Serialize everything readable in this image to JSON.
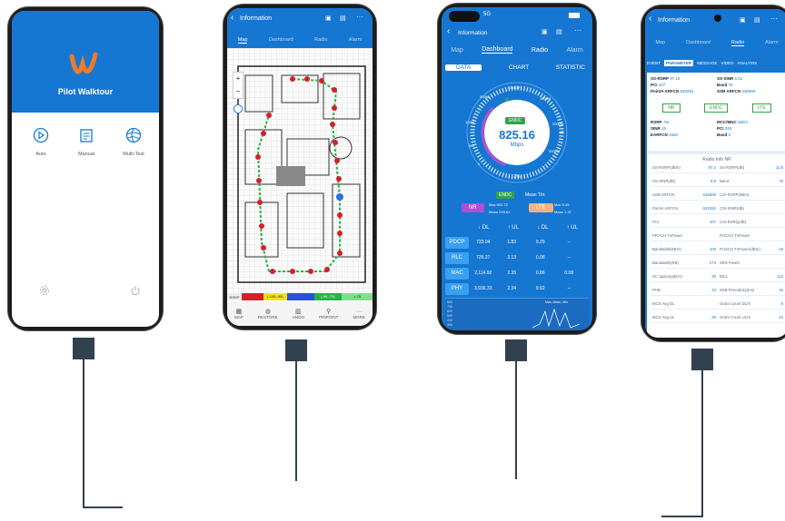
{
  "phone1": {
    "app_name": "Pilot Walktour",
    "modes": [
      {
        "label": "Auto",
        "icon": "play-circle-icon"
      },
      {
        "label": "Manual",
        "icon": "document-icon"
      },
      {
        "label": "Multi-Test",
        "icon": "globe-icon"
      }
    ],
    "footer_icons": [
      "settings-icon",
      "power-icon"
    ],
    "colors": {
      "header": "#1677d2",
      "logo": "#f07a28"
    }
  },
  "phone2": {
    "title": "Information",
    "tabs": [
      "Map",
      "Dashboard",
      "Radio",
      "Alarm"
    ],
    "active_tab": "Map",
    "legend_label": "RSRP",
    "legend_ranges": [
      "[-105,-95)",
      "[-95,-75)"
    ],
    "legend_end": ">-75",
    "toolbar": [
      {
        "label": "MAP",
        "icon": "layers-icon"
      },
      {
        "label": "RESTORE",
        "icon": "restore-icon"
      },
      {
        "label": "UNDO",
        "icon": "trash-icon"
      },
      {
        "label": "PINPOINT",
        "icon": "pin-icon"
      },
      {
        "label": "MORE",
        "icon": "more-icon"
      }
    ]
  },
  "phone3": {
    "status_signal": "5G",
    "title": "Information",
    "tabs": [
      "Map",
      "Dashboard",
      "Radio",
      "Alarm"
    ],
    "active_tab": "Dashboard",
    "subtabs": [
      "DATA",
      "CHART",
      "STATISTIC"
    ],
    "active_subtab": "DATA",
    "gauge": {
      "badge": "ENDC",
      "value": "825.16",
      "unit": "Mbps",
      "percent": "2%",
      "fill_fraction": 0.4,
      "scale": [
        "0",
        "5M",
        "100M",
        "500M",
        "1000M",
        "1500M",
        "2000M",
        "3000M"
      ]
    },
    "endc_row": {
      "badge": "ENDC",
      "mean": "Mean Thr."
    },
    "nr": {
      "label": "NR",
      "max": "Max 902.72",
      "mean": "Mean 249.81"
    },
    "lte": {
      "label": "LTE",
      "max": "Max 9.29",
      "mean": "Mean 1.37"
    },
    "direction_headers": [
      "DL",
      "UL",
      "DL",
      "UL"
    ],
    "layers": [
      {
        "name": "PDCP",
        "v": [
          "733.04",
          "1.83",
          "9.29",
          "--"
        ]
      },
      {
        "name": "RLC",
        "v": [
          "726.27",
          "3.13",
          "0.08",
          "--"
        ]
      },
      {
        "name": "MAC",
        "v": [
          "2,114.92",
          "2.35",
          "0.86",
          "0.08"
        ]
      },
      {
        "name": "PHY",
        "v": [
          "3,936.33",
          "2.34",
          "9.92",
          "--"
        ]
      }
    ],
    "chart_axis": [
      "800",
      "700",
      "600",
      "500",
      "400",
      "300"
    ],
    "chart_legend": "Max, Mean, Min"
  },
  "phone4": {
    "title": "Information",
    "tabs": [
      "Map",
      "Dashboard",
      "Radio",
      "Alarm"
    ],
    "active_tab": "Radio",
    "subtabs": [
      "EVENT",
      "PARAMETER",
      "MESSAGE",
      "VIDEO",
      "ANALYSIS"
    ],
    "active_subtab": "PARAMETER",
    "ss_block": [
      {
        "k": "SS-RSRP",
        "v": "97.19"
      },
      {
        "k": "SS-SINR",
        "v": "5.81"
      },
      {
        "k": "PCI",
        "v": "107"
      },
      {
        "k": "Band",
        "v": "78"
      },
      {
        "k": "PointA ARFCN",
        "v": "633292"
      },
      {
        "k": "SSB ARFCN",
        "v": "636668"
      }
    ],
    "tech_badges": [
      "NR",
      "ENDC",
      "LTE"
    ],
    "lte_block": [
      {
        "k": "RSRP",
        "v": "-94"
      },
      {
        "k": "MCC/MNC",
        "v": "460/1"
      },
      {
        "k": "SINR",
        "v": "15"
      },
      {
        "k": "PCI",
        "v": "330"
      },
      {
        "k": "EARFCN",
        "v": "1650"
      },
      {
        "k": "Band",
        "v": "3"
      }
    ],
    "table_title": "Radio Info NR",
    "table_rows": [
      [
        {
          "k": "SS-RSRP(dBm)",
          "v": "97.2"
        },
        {
          "k": "SS-RSRP(dB)",
          "v": "11.8"
        }
      ],
      [
        {
          "k": "SS-SINR(dB)",
          "v": "5.8"
        },
        {
          "k": "Band",
          "v": "78"
        }
      ],
      [
        {
          "k": "SSB ARFCN",
          "v": "636668"
        },
        {
          "k": "CSI-RSRP(dBm)",
          "v": ""
        }
      ],
      [
        {
          "k": "PointA ARFCN",
          "v": "633292"
        },
        {
          "k": "CSI-SINR(dB)",
          "v": ""
        }
      ],
      [
        {
          "k": "PCI",
          "v": "107"
        },
        {
          "k": "CSI-RSRQ(dB)",
          "v": ""
        }
      ],
      [
        {
          "k": "PRACH TxPower",
          "v": ""
        },
        {
          "k": "PUCCH TxPower",
          "v": ""
        }
      ],
      [
        {
          "k": "Bandwidth(MHz)",
          "v": "100"
        },
        {
          "k": "PUSCH TxPower(dBm)",
          "v": "19"
        }
      ],
      [
        {
          "k": "Bandwidth(RB)",
          "v": "273"
        },
        {
          "k": "SRS Power",
          "v": ""
        }
      ],
      [
        {
          "k": "SC Spacing(kHz)",
          "v": "30"
        },
        {
          "k": "MCL",
          "v": "113"
        }
      ],
      [
        {
          "k": "PHR",
          "v": "33"
        },
        {
          "k": "SSB Periodicity(ms)",
          "v": "20"
        }
      ],
      [
        {
          "k": "MCS Avg DL",
          "v": ""
        },
        {
          "k": "Grant Count DL/S",
          "v": "9"
        }
      ],
      [
        {
          "k": "MCS Avg UL",
          "v": "25"
        },
        {
          "k": "Grant Count UL/S",
          "v": "10"
        }
      ]
    ]
  }
}
